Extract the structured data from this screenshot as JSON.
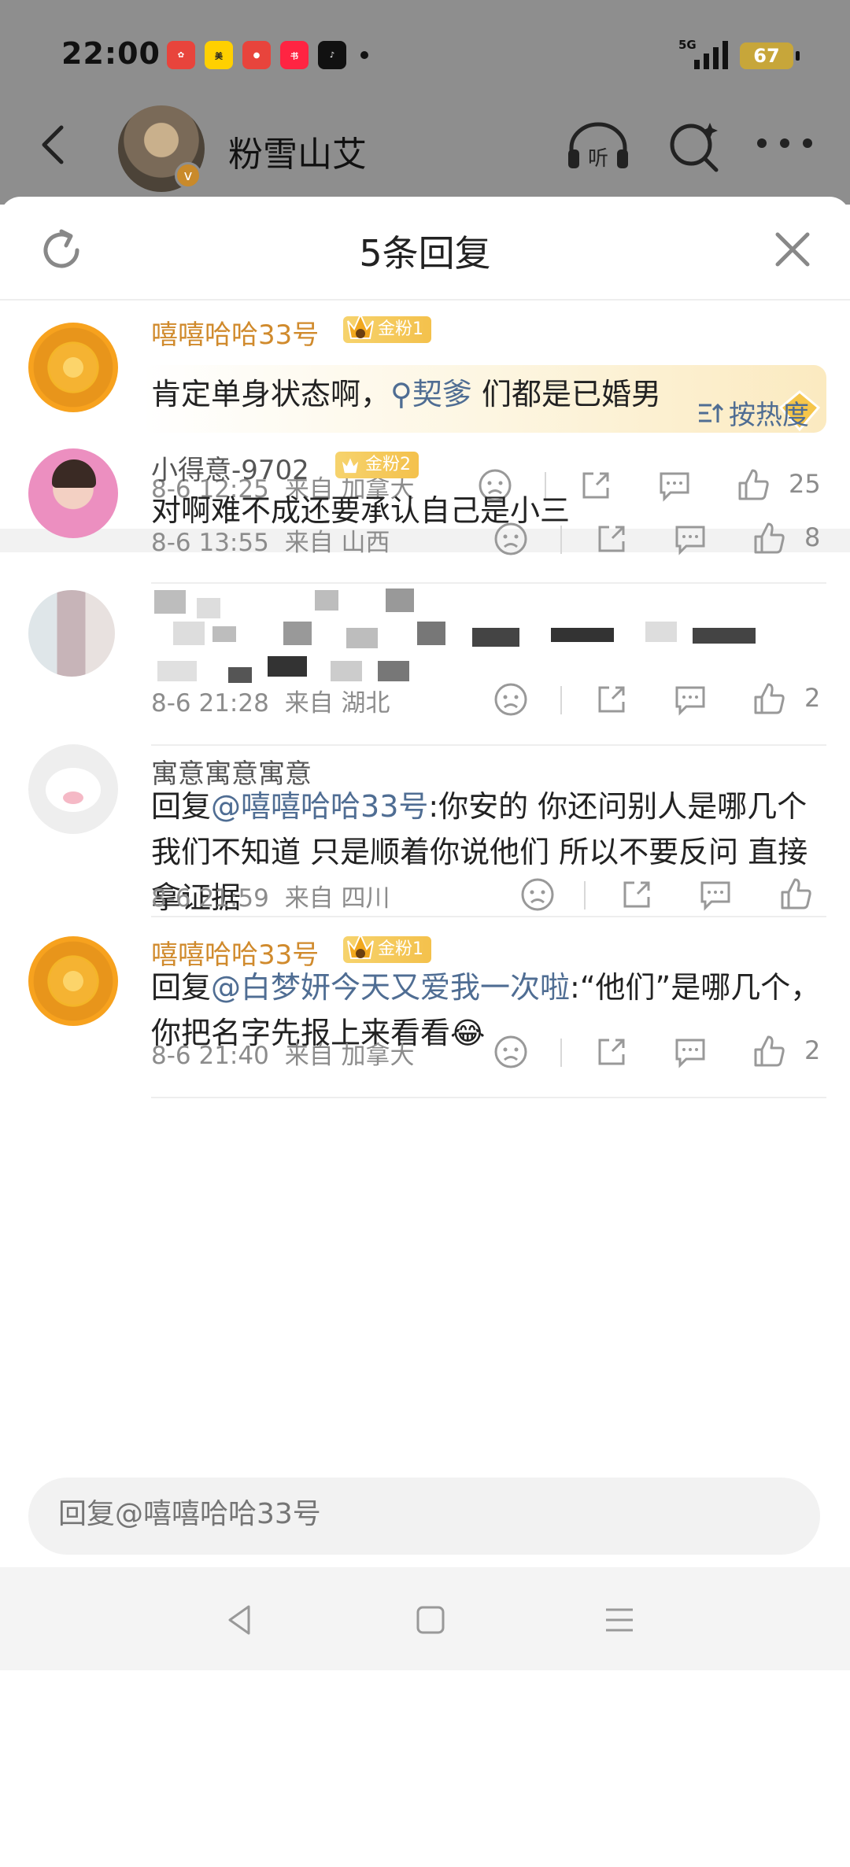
{
  "status_bar": {
    "time": "22:00",
    "network": "5G",
    "battery": "67",
    "app_icons": [
      "mi-icon",
      "meituan-icon",
      "app-icon",
      "xiaohongshu-icon",
      "tiktok-icon"
    ]
  },
  "profile": {
    "name": "粉雪山艾"
  },
  "sheet": {
    "title": "5条回复"
  },
  "featured_comment": {
    "username": "嘻嘻哈哈33号",
    "badge": "金粉1",
    "text_before": "肯定单身状态啊，",
    "topic": "契爹",
    "text_after": "们都是已婚男",
    "time": "8-6 12:25",
    "location": "来自 加拿大",
    "likes": "25"
  },
  "sort_label": "按热度",
  "replies": [
    {
      "username": "小得意-9702",
      "badge": "金粉2",
      "text": "对啊难不成还要承认自己是小三",
      "time": "8-6 13:55",
      "location": "来自 山西",
      "likes": "8"
    },
    {
      "username": "",
      "badge": "",
      "text": "",
      "time": "8-6 21:28",
      "location": "来自 湖北",
      "likes": "2"
    },
    {
      "username": "寓意寓意寓意",
      "badge": "",
      "reply_prefix": "回复",
      "mention": "@嘻嘻哈哈33号",
      "text": ":你安的 你还问别人是哪几个 我们不知道 只是顺着你说他们 所以不要反问 直接拿证据",
      "time": "8-6 21:59",
      "location": "来自 四川",
      "likes": ""
    },
    {
      "username": "嘻嘻哈哈33号",
      "badge": "金粉1",
      "reply_prefix": "回复",
      "mention": "@白梦妍今天又爱我一次啦",
      "text": ":“他们”是哪几个，你把名字先报上来看看😂",
      "time": "8-6 21:40",
      "location": "来自 加拿大",
      "likes": "2"
    }
  ],
  "reply_bar": {
    "placeholder": "回复@嘻嘻哈哈33号"
  },
  "colors": {
    "gold_name": "#d08a2c",
    "link": "#4f6d93",
    "meta": "#8c8c8c"
  }
}
